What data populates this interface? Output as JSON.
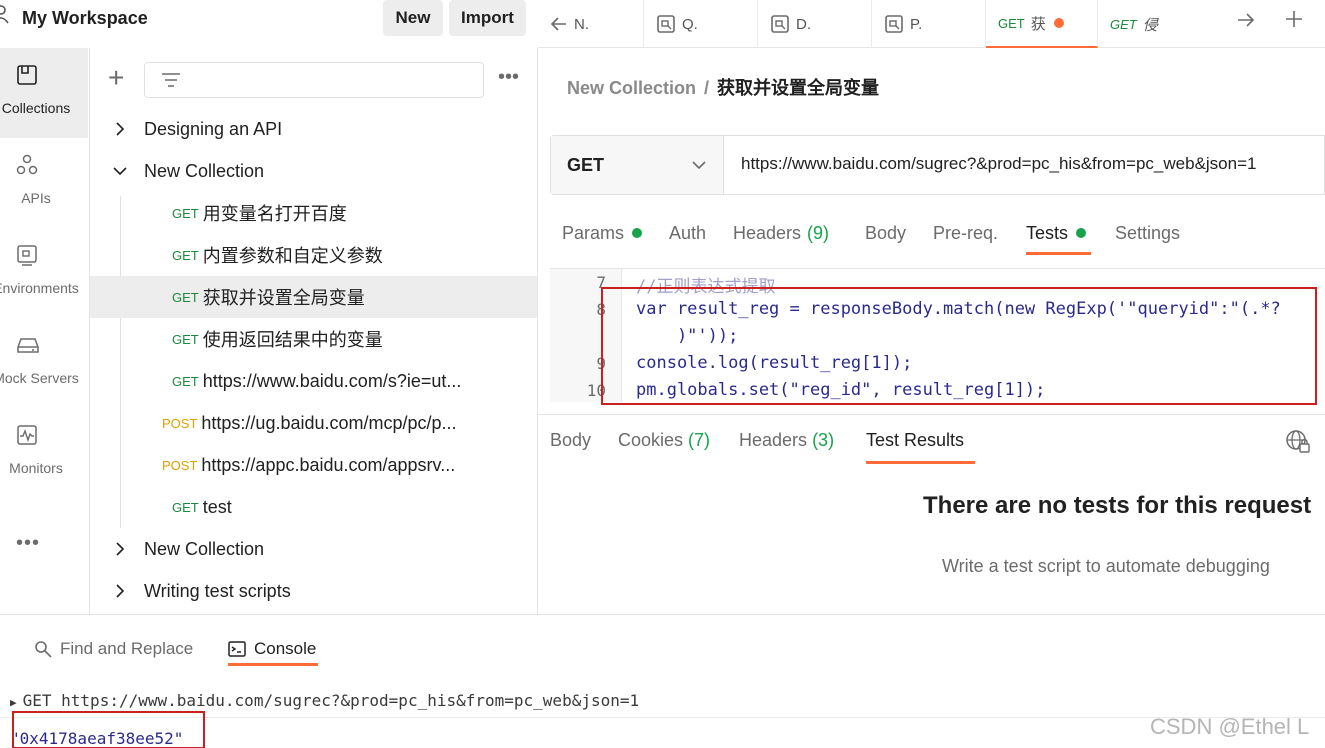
{
  "workspace": {
    "title": "My Workspace",
    "new_label": "New",
    "import_label": "Import"
  },
  "tabs": [
    {
      "label": "N."
    },
    {
      "label": "Q."
    },
    {
      "label": "D."
    },
    {
      "label": "P."
    },
    {
      "method": "GET",
      "label": "获",
      "unsaved": true
    },
    {
      "method": "GET",
      "label": "侵"
    }
  ],
  "rail": {
    "items": [
      {
        "label": "Collections",
        "icon": "collections-icon"
      },
      {
        "label": "APIs",
        "icon": "apis-icon"
      },
      {
        "label": "Environments",
        "icon": "environments-icon"
      },
      {
        "label": "Mock Servers",
        "icon": "mock-servers-icon"
      },
      {
        "label": "Monitors",
        "icon": "monitors-icon"
      }
    ],
    "more": "•••"
  },
  "sidebar": {
    "more": "•••",
    "tree": [
      {
        "type": "folder",
        "name": "Designing an API",
        "expanded": false
      },
      {
        "type": "folder",
        "name": "New Collection",
        "expanded": true
      },
      {
        "type": "request",
        "method": "GET",
        "name": "用变量名打开百度"
      },
      {
        "type": "request",
        "method": "GET",
        "name": "内置参数和自定义参数"
      },
      {
        "type": "request",
        "method": "GET",
        "name": "获取并设置全局变量",
        "selected": true
      },
      {
        "type": "request",
        "method": "GET",
        "name": "使用返回结果中的变量"
      },
      {
        "type": "request",
        "method": "GET",
        "name": "https://www.baidu.com/s?ie=ut..."
      },
      {
        "type": "request",
        "method": "POST",
        "name": "https://ug.baidu.com/mcp/pc/p..."
      },
      {
        "type": "request",
        "method": "POST",
        "name": "https://appc.baidu.com/appsrv..."
      },
      {
        "type": "request",
        "method": "GET",
        "name": "test"
      },
      {
        "type": "folder",
        "name": "New Collection",
        "expanded": false
      },
      {
        "type": "folder",
        "name": "Writing test scripts",
        "expanded": false
      }
    ]
  },
  "request": {
    "breadcrumb_parent": "New Collection",
    "breadcrumb_sep": "/",
    "breadcrumb_current": "获取并设置全局变量",
    "method": "GET",
    "url": "https://www.baidu.com/sugrec?&prod=pc_his&from=pc_web&json=1",
    "tabs": {
      "params": "Params",
      "auth": "Auth",
      "headers": "Headers",
      "headers_count": "(9)",
      "body": "Body",
      "prereq": "Pre-req.",
      "tests": "Tests",
      "settings": "Settings"
    }
  },
  "editor": {
    "lines": [
      {
        "num": "7",
        "code": "//正则表达式提取"
      },
      {
        "num": "8",
        "code": "var result_reg = responseBody.match(new RegExp('\"queryid\":\"(.*?"
      },
      {
        "num": "",
        "code": "    )\"'));"
      },
      {
        "num": "9",
        "code": "console.log(result_reg[1]);"
      },
      {
        "num": "10",
        "code": "pm.globals.set(\"reg_id\", result_reg[1]);"
      }
    ]
  },
  "response": {
    "tabs": {
      "body": "Body",
      "cookies": "Cookies",
      "cookies_count": "(7)",
      "headers": "Headers",
      "headers_count": "(3)",
      "test_results": "Test Results"
    },
    "empty_title": "There are no tests for this request",
    "empty_subtitle": "Write a test script to automate debugging"
  },
  "console": {
    "find_replace": "Find and Replace",
    "console_label": "Console",
    "log_request": "GET https://www.baidu.com/sugrec?&prod=pc_his&from=pc_web&json=1",
    "log_value": "\"0x4178aeaf38ee52\""
  },
  "watermark": "CSDN @Ethel L",
  "colors": {
    "accent": "#ff6c37",
    "get": "#1a8a3c",
    "post": "#e0a100",
    "success": "#16a34a",
    "highlight": "#cc1f1f"
  }
}
